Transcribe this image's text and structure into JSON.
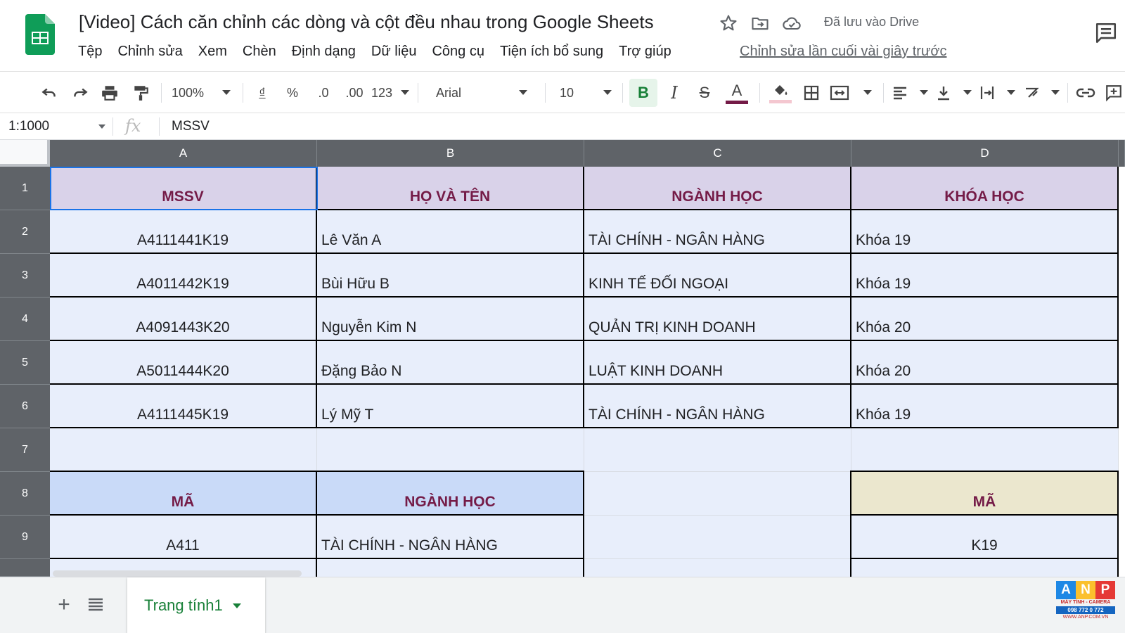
{
  "document": {
    "title": "[Video] Cách căn chỉnh các dòng và cột đều nhau trong Google Sheets",
    "saved_status": "Đã lưu vào Drive",
    "last_edit": "Chỉnh sửa lần cuối vài giây trước"
  },
  "menu": [
    "Tệp",
    "Chỉnh sửa",
    "Xem",
    "Chèn",
    "Định dạng",
    "Dữ liệu",
    "Công cụ",
    "Tiện ích bổ sung",
    "Trợ giúp"
  ],
  "toolbar": {
    "zoom": "100%",
    "currency": "₫",
    "percent": "%",
    "decrease_decimal": ".0",
    "increase_decimal": ".00",
    "more_formats": "123",
    "font": "Arial",
    "font_size": "10",
    "bold": "B",
    "italic": "I",
    "strike": "S",
    "text_color_glyph": "A",
    "text_color": "#741b47",
    "fill_color": "#f4c7d0"
  },
  "formula_bar": {
    "name_box": "1:1000",
    "fx": "fx",
    "value": "MSSV"
  },
  "columns": [
    "A",
    "B",
    "C",
    "D"
  ],
  "rows": [
    "1",
    "2",
    "3",
    "4",
    "5",
    "6",
    "7",
    "8",
    "9"
  ],
  "cells": {
    "r1": [
      "MSSV",
      "HỌ VÀ TÊN",
      "NGÀNH HỌC",
      "KHÓA HỌC"
    ],
    "r2": [
      "A4111441K19",
      "Lê Văn A",
      "TÀI CHÍNH - NGÂN HÀNG",
      "Khóa 19"
    ],
    "r3": [
      "A4011442K19",
      "Bùi Hữu B",
      "KINH TẾ ĐỐI NGOẠI",
      "Khóa 19"
    ],
    "r4": [
      "A4091443K20",
      "Nguyễn Kim N",
      "QUẢN TRỊ KINH DOANH",
      "Khóa 20"
    ],
    "r5": [
      "A5011444K20",
      "Đặng Bảo N",
      "LUẬT KINH DOANH",
      "Khóa 20"
    ],
    "r6": [
      "A4111445K19",
      "Lý Mỹ T",
      "TÀI CHÍNH - NGÂN HÀNG",
      "Khóa 19"
    ],
    "r7": [
      "",
      "",
      "",
      ""
    ],
    "r8": [
      "MÃ",
      "NGÀNH HỌC",
      "",
      "MÃ"
    ],
    "r9": [
      "A411",
      "TÀI CHÍNH - NGÂN HÀNG",
      "",
      "K19"
    ]
  },
  "colors": {
    "header_fill": "#d9d2e9",
    "header_text": "#741b47",
    "data_fill": "#e8eefb",
    "code_header_fill": "#c9daf8",
    "course_header_fill": "#ebe7ce",
    "selection": "#1a73e8",
    "sheets_green": "#188038"
  },
  "sheet_tab": "Trang tính1",
  "watermark": {
    "letters": [
      "A",
      "N",
      "P"
    ],
    "line": "MÁY TÍNH - CAMERA",
    "phone": "098 772 0 772",
    "web": "WWW.ANP.COM.VN"
  }
}
